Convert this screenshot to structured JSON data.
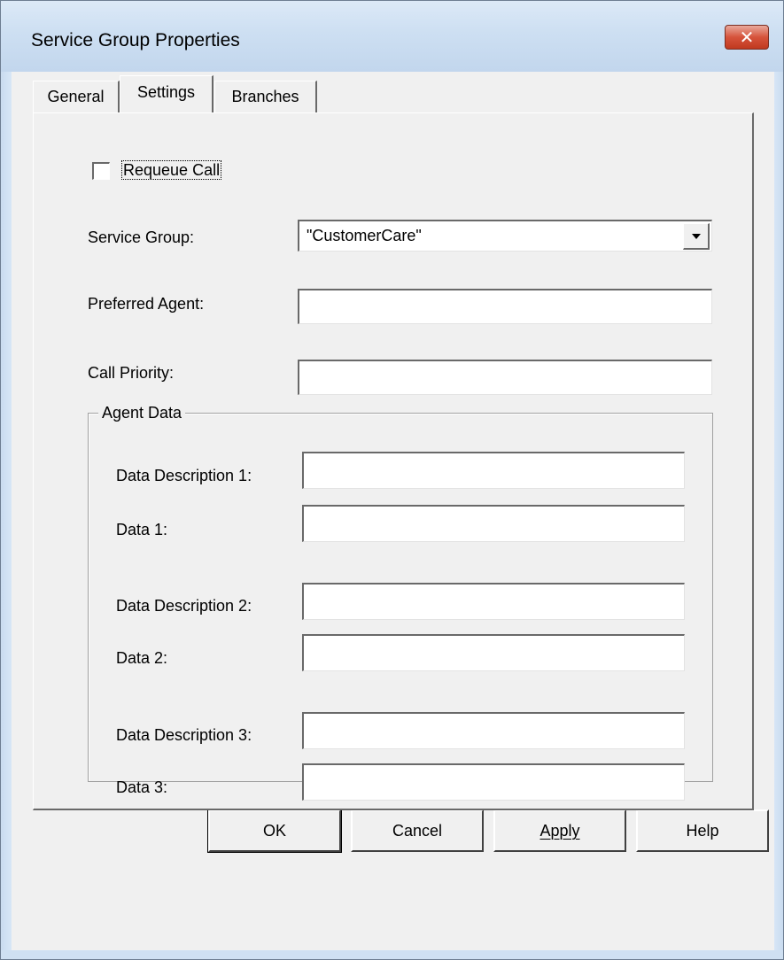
{
  "window": {
    "title": "Service Group Properties",
    "close_glyph": "✕"
  },
  "tabs": [
    {
      "label": "General",
      "active": false
    },
    {
      "label": "Settings",
      "active": true
    },
    {
      "label": "Branches",
      "active": false
    }
  ],
  "settings": {
    "requeue_call": {
      "label": "Requeue Call",
      "checked": false
    },
    "service_group": {
      "label": "Service Group:",
      "value": "\"CustomerCare\""
    },
    "preferred_agent": {
      "label": "Preferred Agent:",
      "value": ""
    },
    "call_priority": {
      "label": "Call Priority:",
      "value": ""
    },
    "agent_data": {
      "title": "Agent Data",
      "rows": [
        {
          "label": "Data Description 1:",
          "value": ""
        },
        {
          "label": "Data 1:",
          "value": ""
        },
        {
          "label": "Data Description 2:",
          "value": ""
        },
        {
          "label": "Data 2:",
          "value": ""
        },
        {
          "label": "Data Description 3:",
          "value": ""
        },
        {
          "label": "Data 3:",
          "value": ""
        }
      ]
    }
  },
  "buttons": {
    "ok": "OK",
    "cancel": "Cancel",
    "apply": "Apply",
    "help": "Help"
  },
  "icons": {
    "close": "close-icon",
    "dropdown": "chevron-down-icon"
  }
}
